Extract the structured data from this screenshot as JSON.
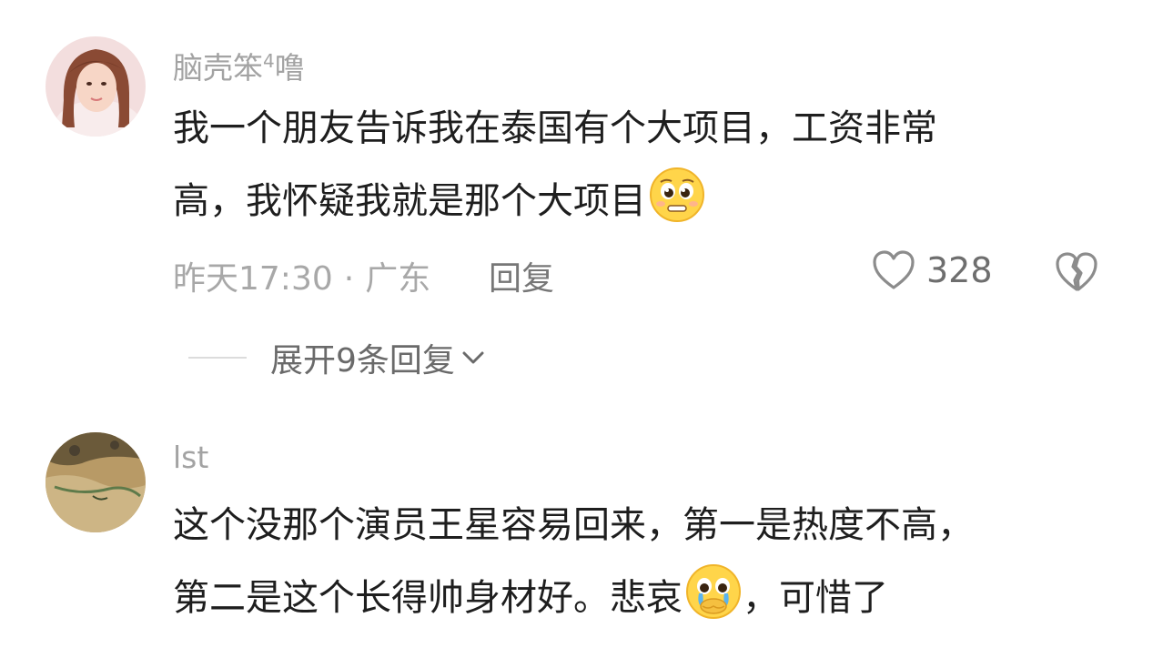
{
  "comments": [
    {
      "avatar_icon": "user-avatar-photo",
      "username": "脑壳笨",
      "username_sup": "4",
      "username_suffix": "噜",
      "line1": "我一个朋友告诉我在泰国有个大项目，工资非常",
      "line2": "高，我怀疑我就是那个大项目",
      "emoji": "pleading-face-emoji",
      "time": "昨天17:30",
      "separator": "·",
      "location": "广东",
      "reply_label": "回复",
      "like_count": "328",
      "like_icon": "heart-outline-icon",
      "dislike_icon": "broken-heart-icon",
      "expand_label": "展开9条回复",
      "expand_icon": "chevron-down-icon"
    },
    {
      "avatar_icon": "user-avatar-landscape",
      "username": "lst",
      "line1": "这个没那个演员王星容易回来，第一是热度不高，",
      "line2_part1": "第二是这个长得帅身材好。悲哀",
      "line2_part2": "，可惜了",
      "emoji": "crying-face-emoji"
    }
  ],
  "colors": {
    "username": "#a3a3a3",
    "body_text": "#1e1e1e",
    "meta": "#a8a8a8",
    "icon": "#8c8c8c",
    "emoji_yellow": "#ffd54a"
  }
}
